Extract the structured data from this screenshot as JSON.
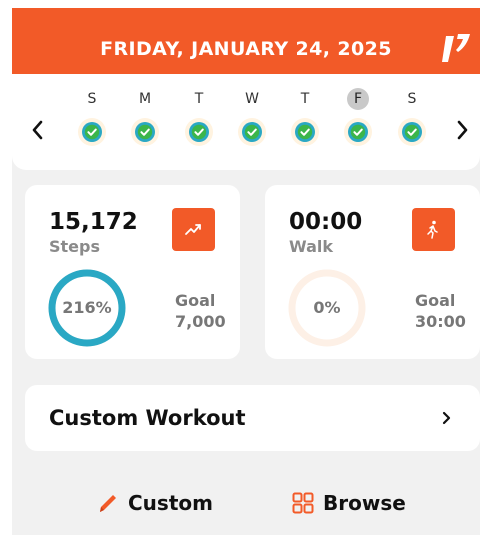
{
  "header": {
    "title": "FRIDAY, JANUARY 24, 2025"
  },
  "week": {
    "days": [
      {
        "letter": "S",
        "completed": true,
        "active": false
      },
      {
        "letter": "M",
        "completed": true,
        "active": false
      },
      {
        "letter": "T",
        "completed": true,
        "active": false
      },
      {
        "letter": "W",
        "completed": true,
        "active": false
      },
      {
        "letter": "T",
        "completed": true,
        "active": false
      },
      {
        "letter": "F",
        "completed": true,
        "active": true
      },
      {
        "letter": "S",
        "completed": true,
        "active": false
      }
    ]
  },
  "steps": {
    "value": "15,172",
    "label": "Steps",
    "percent_text": "216%",
    "progress": 1.0,
    "goal_label": "Goal",
    "goal_value": "7,000",
    "icon": "trending-up-icon"
  },
  "walk": {
    "value": "00:00",
    "label": "Walk",
    "percent_text": "0%",
    "progress": 0,
    "goal_label": "Goal",
    "goal_value": "30:00",
    "icon": "walking-person-icon"
  },
  "workout": {
    "title": "Custom Workout"
  },
  "actions": {
    "custom_label": "Custom",
    "browse_label": "Browse"
  },
  "colors": {
    "accent": "#f25a28",
    "ring": "#2aa8c4",
    "ring_empty": "#fdf0e6",
    "check_outer": "#2aa8c4",
    "check_inner": "#3bb54a"
  }
}
